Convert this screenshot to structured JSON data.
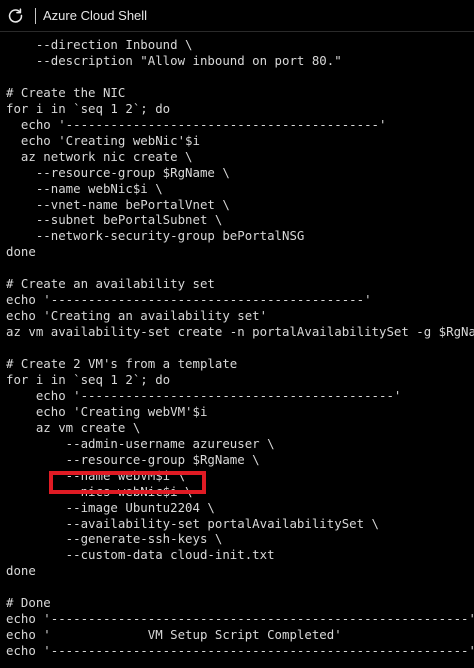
{
  "header": {
    "title": "Azure Cloud Shell",
    "refresh_icon": "refresh-icon"
  },
  "terminal": {
    "lines": [
      "    --direction Inbound \\",
      "    --description \"Allow inbound on port 80.\"",
      "",
      "# Create the NIC",
      "for i in `seq 1 2`; do",
      "  echo '------------------------------------------'",
      "  echo 'Creating webNic'$i",
      "  az network nic create \\",
      "    --resource-group $RgName \\",
      "    --name webNic$i \\",
      "    --vnet-name bePortalVnet \\",
      "    --subnet bePortalSubnet \\",
      "    --network-security-group bePortalNSG",
      "done",
      "",
      "# Create an availability set",
      "echo '------------------------------------------'",
      "echo 'Creating an availability set'",
      "az vm availability-set create -n portalAvailabilitySet -g $RgName",
      "",
      "# Create 2 VM's from a template",
      "for i in `seq 1 2`; do",
      "    echo '------------------------------------------'",
      "    echo 'Creating webVM'$i",
      "    az vm create \\",
      "        --admin-username azureuser \\",
      "        --resource-group $RgName \\",
      "        --name webVM$i \\",
      "        --nics webNic$i \\",
      "        --image Ubuntu2204 \\",
      "        --availability-set portalAvailabilitySet \\",
      "        --generate-ssh-keys \\",
      "        --custom-data cloud-init.txt",
      "done",
      "",
      "# Done",
      "echo '--------------------------------------------------------'",
      "echo '             VM Setup Script Completed'",
      "echo '--------------------------------------------------------'"
    ]
  },
  "annotation": {
    "highlight_color": "#e01b24",
    "highlighted_line": "        --image Ubuntu2204 \\"
  },
  "colors": {
    "background": "#000000",
    "text": "#d8d8d8"
  }
}
